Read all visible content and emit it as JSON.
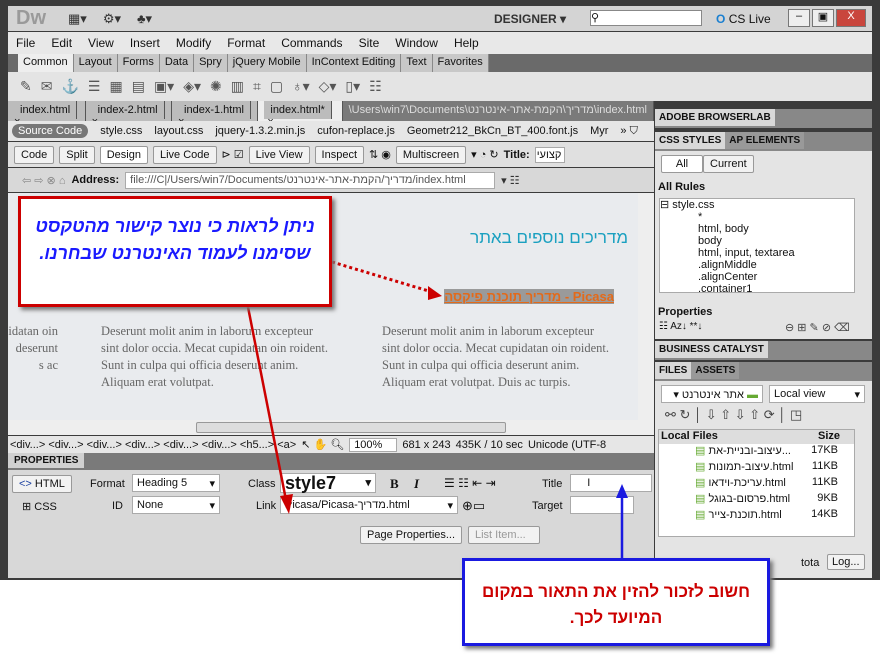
{
  "app": {
    "logo": "Dw",
    "workspace": "DESIGNER",
    "cs_live": "CS Live"
  },
  "menu": [
    "File",
    "Edit",
    "View",
    "Insert",
    "Modify",
    "Format",
    "Commands",
    "Site",
    "Window",
    "Help"
  ],
  "insert_tabs": [
    "Common",
    "Layout",
    "Forms",
    "Data",
    "Spry",
    "jQuery Mobile",
    "InContext Editing",
    "Text",
    "Favorites"
  ],
  "doc_tabs": [
    "index.html",
    "index-2.html",
    "index-1.html",
    "index.html*"
  ],
  "doc_path": "\\Users\\win7\\Documents\\מדריך\\הקמת-אתר-אינטרנט\\index.html",
  "related_files": {
    "source": "Source Code",
    "files": [
      "style.css",
      "layout.css",
      "jquery-1.3.2.min.js",
      "cufon-replace.js",
      "Geometr212_BkCn_BT_400.font.js",
      "Myr"
    ]
  },
  "doc_toolbar": {
    "code": "Code",
    "split": "Split",
    "design": "Design",
    "live_code": "Live Code",
    "live_view": "Live View",
    "inspect": "Inspect",
    "multiscreen": "Multiscreen",
    "title_label": "Title:",
    "title_value": "קצועי"
  },
  "address": {
    "label": "Address:",
    "value": "file:///C|/Users/win7/Documents/מדריך/הקמת-אתר-אינטרנט/index.html"
  },
  "design": {
    "heading": "מדריכים נוספים באתר",
    "link": "מדריך תוכנת פיקסה - Picasa",
    "col0": "idatan oin deserunt s ac",
    "col1": "Deserunt molit anim in laborum excepteur sint dolor occia. Mecat cupidatan oin roident. Sunt in culpa qui officia deserunt anim. Aliquam erat volutpat.",
    "col2": "Deserunt molit anim in laborum excepteur sint dolor occia. Mecat cupidatan oin roident. Sunt in culpa qui officia deserunt anim. Aliquam erat volutpat. Duis ac turpis."
  },
  "status": {
    "tags": "<div...> <div...> <div...> <div...> <div...> <div...> <h5...> <a>",
    "zoom": "100%",
    "size": "681 x 243",
    "download": "435K / 10 sec",
    "encoding": "Unicode (UTF-8"
  },
  "properties": {
    "header": "PROPERTIES",
    "html": "HTML",
    "css": "CSS",
    "format_label": "Format",
    "format": "Heading 5",
    "id_label": "ID",
    "id": "None",
    "class_label": "Class",
    "class": "style7",
    "link_label": "Link",
    "link": "Picasa/Picasa-מדריך.html",
    "title_label": "Title",
    "target_label": "Target",
    "bold": "B",
    "italic": "I",
    "page_props": "Page Properties...",
    "list_item": "List Item..."
  },
  "right": {
    "browserlab": "ADOBE BROWSERLAB",
    "css_styles": "CSS STYLES",
    "ap": "AP ELEMENTS",
    "all": "All",
    "current": "Current",
    "all_rules": "All Rules",
    "rules": [
      "style.css",
      "*",
      "html, body",
      "body",
      "html, input, textarea",
      ".alignMiddle",
      ".alignCenter",
      ".container1"
    ],
    "properties": "Properties",
    "bc": "BUSINESS CATALYST",
    "files": "FILES",
    "assets": "ASSETS",
    "site": "אתר אינטרנט",
    "view": "Local view",
    "local_files": "Local Files",
    "size": "Size",
    "file_list": [
      {
        "name": "עיצוב-ובניית-את...",
        "size": "17KB"
      },
      {
        "name": "עיצוב-תמונות.html",
        "size": "11KB"
      },
      {
        "name": "עריכת-וידאו.html",
        "size": "11KB"
      },
      {
        "name": "פרסום-בגוגל.html",
        "size": "9KB"
      },
      {
        "name": "תוכנת-צייר.html",
        "size": "14KB"
      }
    ],
    "tota": "tota",
    "log": "Log..."
  },
  "callouts": {
    "red": "ניתן לראות כי נוצר קישור מהטקסט שסימנו לעמוד האינטרנט שבחרנו.",
    "blue": "חשוב לזכור להזין את התאור במקום המיועד לכך."
  },
  "colors": {
    "callout_red": "#cc0000",
    "callout_blue": "#1a1ae0",
    "heading": "#1aa0c0",
    "link": "#e36a1a"
  }
}
